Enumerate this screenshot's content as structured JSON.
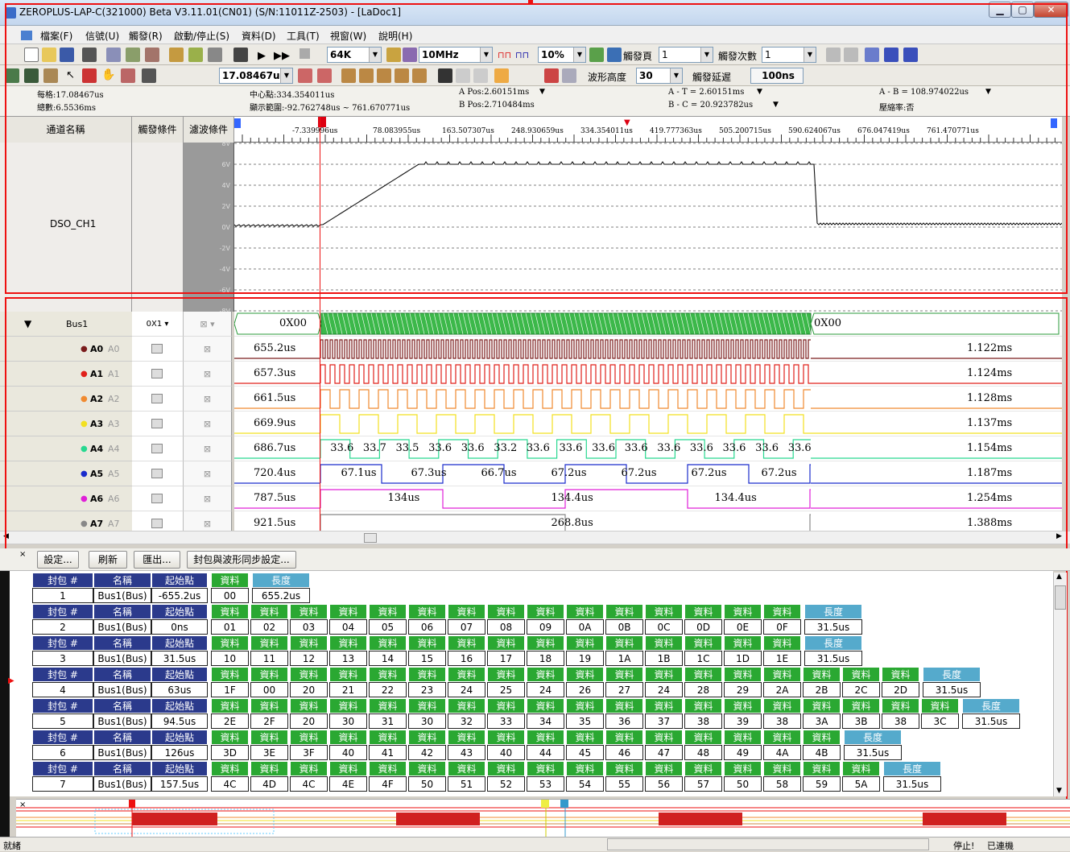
{
  "app": {
    "title": "ZEROPLUS-LAP-C(321000) Beta V3.11.01(CN01) (S/N:11011Z-2503) - [LaDoc1]"
  },
  "menu": [
    "檔案(F)",
    "信號(U)",
    "觸發(R)",
    "啟動/停止(S)",
    "資料(D)",
    "工具(T)",
    "視窗(W)",
    "說明(H)"
  ],
  "toolbar": {
    "memory": "64K",
    "freq": "10MHz",
    "percent": "10%",
    "trig_page_label": "觸發頁",
    "trig_page": "1",
    "trig_count_label": "觸發次數",
    "trig_count": "1",
    "unit": "17.08467u",
    "wave_height_label": "波形高度",
    "wave_height": "30",
    "trig_delay_label": "觸發延遲",
    "trig_delay": "100ns"
  },
  "info": {
    "per_div": "每格:17.08467us",
    "total": "總數:6.5536ms",
    "center": "中心點:334.354011us",
    "range": "顯示範圍:-92.762748us ~ 761.670771us",
    "a_pos": "A Pos:2.60151ms",
    "b_pos": "B Pos:2.710484ms",
    "a_t": "A - T = 2.60151ms",
    "b_c": "B - C = 20.923782us",
    "a_b": "A - B = 108.974022us",
    "compress": "壓縮率:否"
  },
  "headers": {
    "name": "通道名稱",
    "trigger": "觸發條件",
    "filter": "濾波條件"
  },
  "ruler": [
    "-7.339996us",
    "78.083955us",
    "163.507307us",
    "248.930659us",
    "334.354011us",
    "419.777363us",
    "505.200715us",
    "590.624067us",
    "676.047419us",
    "761.470771us"
  ],
  "dso": {
    "name": "DSO_CH1",
    "levels": [
      "8V",
      "6V",
      "4V",
      "2V",
      "0V",
      "-2V",
      "-4V",
      "-6V",
      "-8V"
    ]
  },
  "bus": {
    "name": "Bus1",
    "trig": "0X1",
    "val_start": "0X00",
    "val_end": "0X00"
  },
  "channels": [
    {
      "name": "A0",
      "sub": "A0",
      "color": "#7a1c1c",
      "left": "655.2us",
      "right": "1.122ms",
      "labels": []
    },
    {
      "name": "A1",
      "sub": "A1",
      "color": "#e0201a",
      "left": "657.3us",
      "right": "1.124ms",
      "labels": []
    },
    {
      "name": "A2",
      "sub": "A2",
      "color": "#f08a30",
      "left": "661.5us",
      "right": "1.128ms",
      "labels": []
    },
    {
      "name": "A3",
      "sub": "A3",
      "color": "#f2e020",
      "left": "669.9us",
      "right": "1.137ms",
      "labels": []
    },
    {
      "name": "A4",
      "sub": "A4",
      "color": "#28d890",
      "left": "686.7us",
      "right": "1.154ms",
      "labels": [
        "33.6",
        "33.7",
        "33.5",
        "33.6",
        "33.6",
        "33.2",
        "33.6",
        "33.6",
        "33.6",
        "33.6",
        "33.6",
        "33.6",
        "33.6",
        "33.6",
        "33.6"
      ]
    },
    {
      "name": "A5",
      "sub": "A5",
      "color": "#1a2ccc",
      "left": "720.4us",
      "right": "1.187ms",
      "labels": [
        "67.1us",
        "67.3us",
        "66.7us",
        "67.2us",
        "67.2us",
        "67.2us",
        "67.2us"
      ]
    },
    {
      "name": "A6",
      "sub": "A6",
      "color": "#e020d8",
      "left": "787.5us",
      "right": "1.254ms",
      "labels": [
        "134us",
        "134.4us",
        "134.4us"
      ]
    },
    {
      "name": "A7",
      "sub": "A7",
      "color": "#888888",
      "left": "921.5us",
      "right": "1.388ms",
      "labels": [
        "268.8us"
      ]
    }
  ],
  "decode_bar": {
    "settings": "設定...",
    "refresh": "刷新",
    "export": "匯出...",
    "sync": "封包與波形同步設定..."
  },
  "table_headers": {
    "packet": "封包 #",
    "name": "名稱",
    "start": "起始點",
    "data": "資料",
    "length": "長度"
  },
  "packets": [
    {
      "no": "1",
      "name": "Bus1(Bus)",
      "start": "-655.2us",
      "data": [
        "00"
      ],
      "len": "655.2us"
    },
    {
      "no": "2",
      "name": "Bus1(Bus)",
      "start": "0ns",
      "data": [
        "01",
        "02",
        "03",
        "04",
        "05",
        "06",
        "07",
        "08",
        "09",
        "0A",
        "0B",
        "0C",
        "0D",
        "0E",
        "0F"
      ],
      "len": "31.5us"
    },
    {
      "no": "3",
      "name": "Bus1(Bus)",
      "start": "31.5us",
      "data": [
        "10",
        "11",
        "12",
        "13",
        "14",
        "15",
        "16",
        "17",
        "18",
        "19",
        "1A",
        "1B",
        "1C",
        "1D",
        "1E"
      ],
      "len": "31.5us"
    },
    {
      "no": "4",
      "name": "Bus1(Bus)",
      "start": "63us",
      "data": [
        "1F",
        "00",
        "20",
        "21",
        "22",
        "23",
        "24",
        "25",
        "24",
        "26",
        "27",
        "24",
        "28",
        "29",
        "2A",
        "2B",
        "2C",
        "2D"
      ],
      "len": "31.5us"
    },
    {
      "no": "5",
      "name": "Bus1(Bus)",
      "start": "94.5us",
      "data": [
        "2E",
        "2F",
        "20",
        "30",
        "31",
        "30",
        "32",
        "33",
        "34",
        "35",
        "36",
        "37",
        "38",
        "39",
        "38",
        "3A",
        "3B",
        "38",
        "3C"
      ],
      "len": "31.5us"
    },
    {
      "no": "6",
      "name": "Bus1(Bus)",
      "start": "126us",
      "data": [
        "3D",
        "3E",
        "3F",
        "40",
        "41",
        "42",
        "43",
        "40",
        "44",
        "45",
        "46",
        "47",
        "48",
        "49",
        "4A",
        "4B"
      ],
      "len": "31.5us"
    },
    {
      "no": "7",
      "name": "Bus1(Bus)",
      "start": "157.5us",
      "data": [
        "4C",
        "4D",
        "4C",
        "4E",
        "4F",
        "50",
        "51",
        "52",
        "53",
        "54",
        "55",
        "56",
        "57",
        "50",
        "58",
        "59",
        "5A"
      ],
      "len": "31.5us"
    }
  ],
  "status": {
    "ready": "就緒",
    "stopped": "停止!",
    "connected": "已連機"
  },
  "colors": {
    "header_blue": "#2b3a8c",
    "data_green": "#2aa832",
    "length_cyan": "#55aacc",
    "red": "#e11111"
  }
}
